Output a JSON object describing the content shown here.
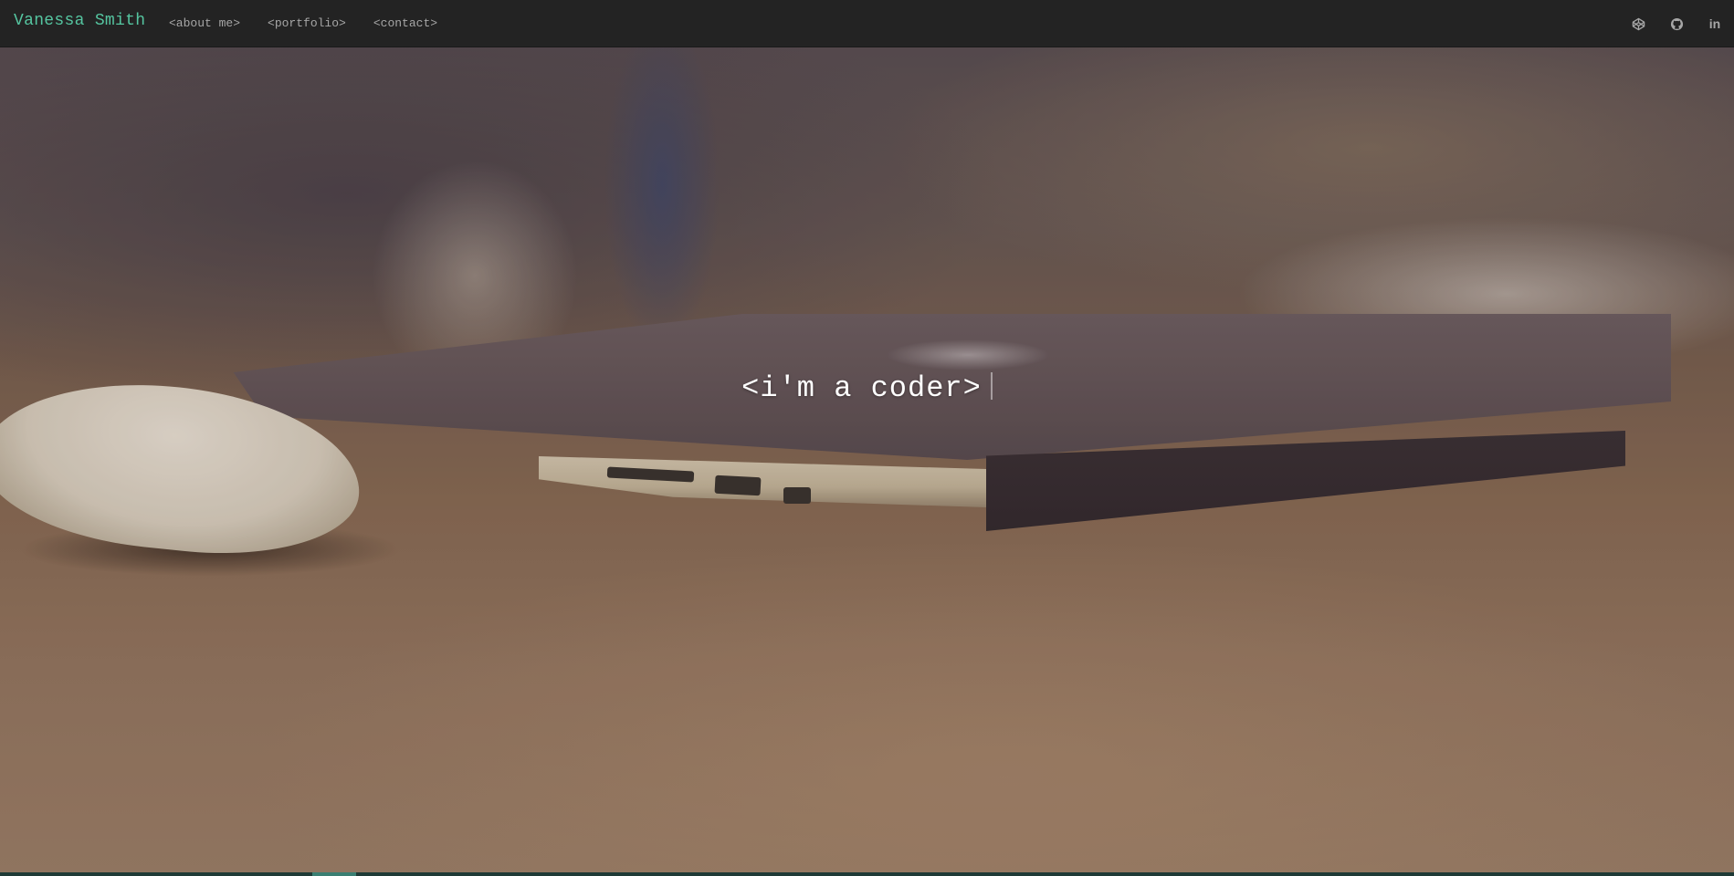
{
  "nav": {
    "brand": "Vanessa Smith",
    "links": [
      {
        "label": "<about me>"
      },
      {
        "label": "<portfolio>"
      },
      {
        "label": "<contact>"
      }
    ],
    "social": [
      {
        "icon": "codepen-icon"
      },
      {
        "icon": "github-icon"
      },
      {
        "icon": "linkedin-icon",
        "label": "in"
      }
    ]
  },
  "hero": {
    "headline": "<i'm a coder>"
  },
  "colors": {
    "accent": "#55c5a0",
    "navbar_bg": "#232323",
    "nav_link": "#a6a6a6",
    "headline": "#ffffff"
  }
}
